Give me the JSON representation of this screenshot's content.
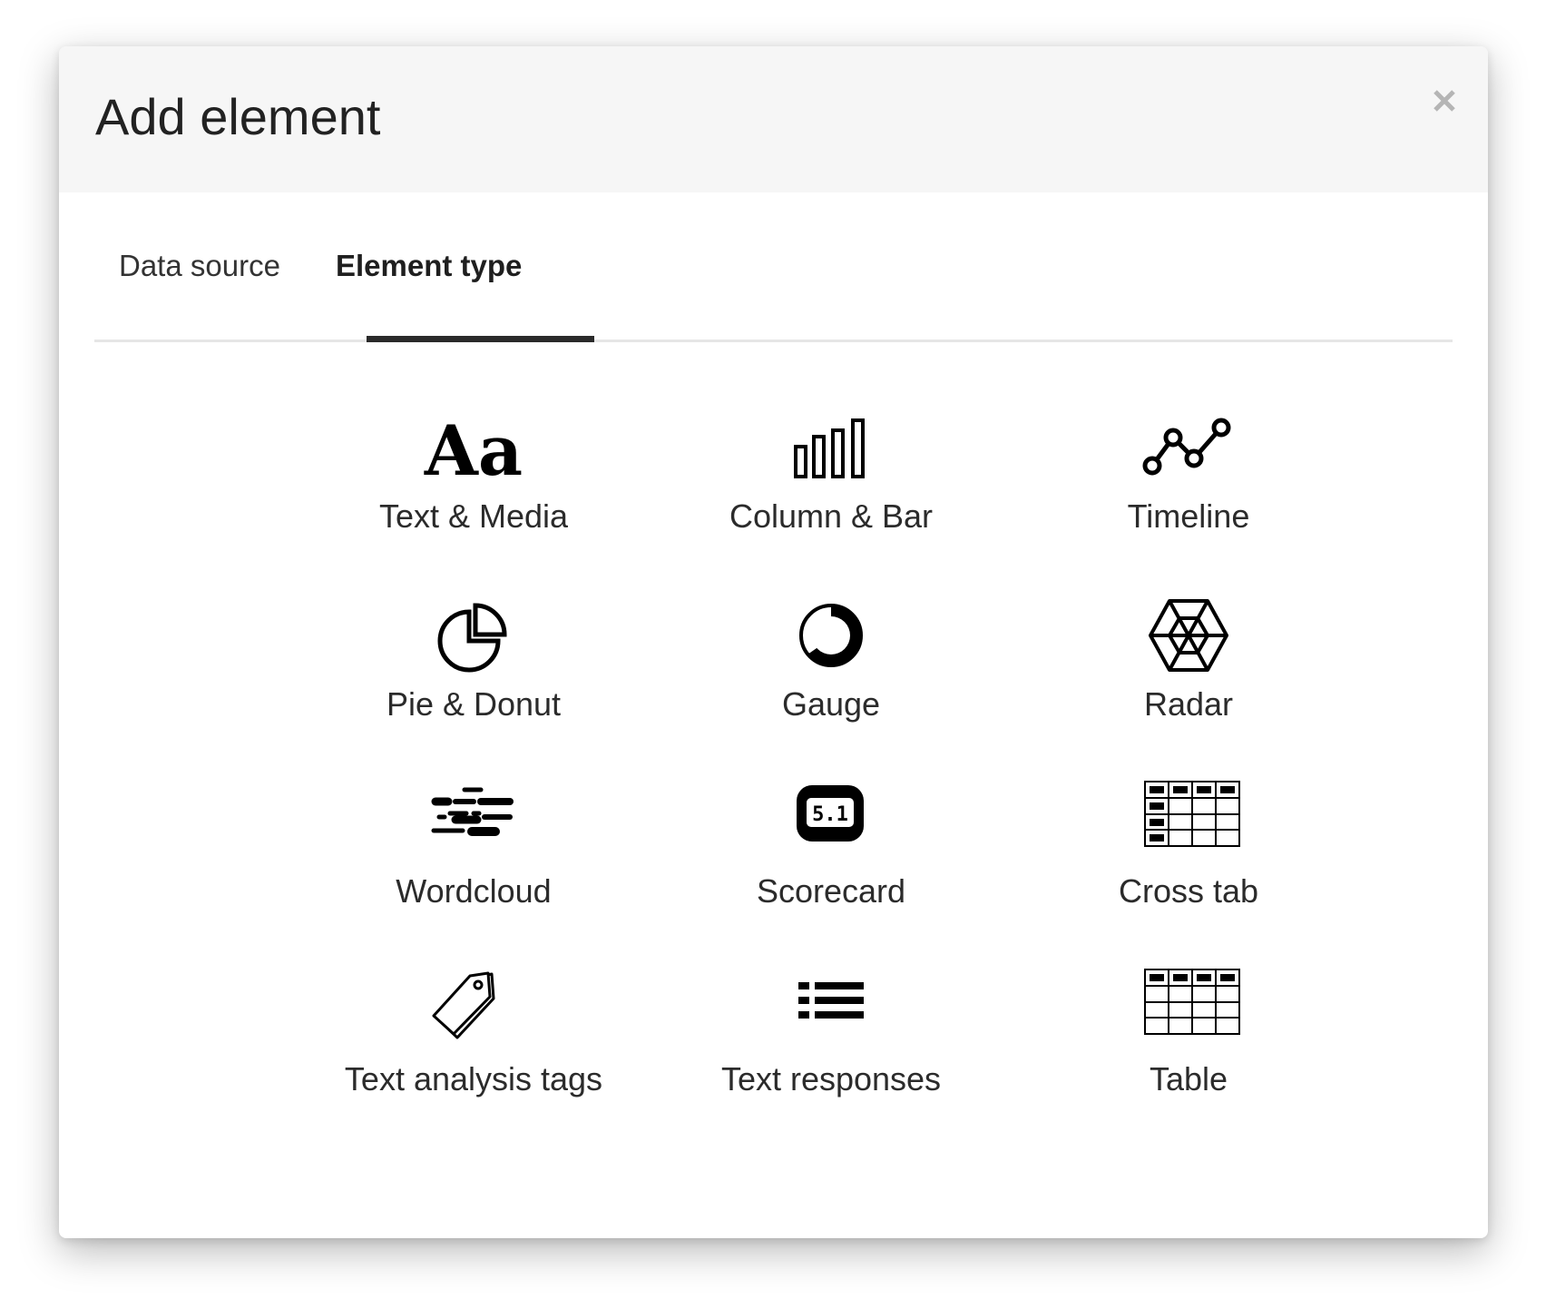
{
  "modal": {
    "title": "Add element",
    "close_icon": "close-icon"
  },
  "tabs": [
    {
      "label": "Data source",
      "active": false
    },
    {
      "label": "Element type",
      "active": true
    }
  ],
  "element_types": [
    {
      "label": "Text & Media",
      "icon": "text-media-icon"
    },
    {
      "label": "Column & Bar",
      "icon": "column-bar-icon"
    },
    {
      "label": "Timeline",
      "icon": "timeline-icon"
    },
    {
      "label": "Pie & Donut",
      "icon": "pie-donut-icon"
    },
    {
      "label": "Gauge",
      "icon": "gauge-icon"
    },
    {
      "label": "Radar",
      "icon": "radar-icon"
    },
    {
      "label": "Wordcloud",
      "icon": "wordcloud-icon"
    },
    {
      "label": "Scorecard",
      "icon": "scorecard-icon",
      "icon_text": "5.1"
    },
    {
      "label": "Cross tab",
      "icon": "cross-tab-icon"
    },
    {
      "label": "Text analysis tags",
      "icon": "tag-icon"
    },
    {
      "label": "Text responses",
      "icon": "list-icon"
    },
    {
      "label": "Table",
      "icon": "table-icon"
    }
  ],
  "icon_glyphs": {
    "text_media": "Aa"
  },
  "colors": {
    "header_bg": "#f6f6f6",
    "text": "#2b2b2b",
    "active_tab_underline": "#2a2a2a",
    "close_icon": "#b5b5b5"
  }
}
